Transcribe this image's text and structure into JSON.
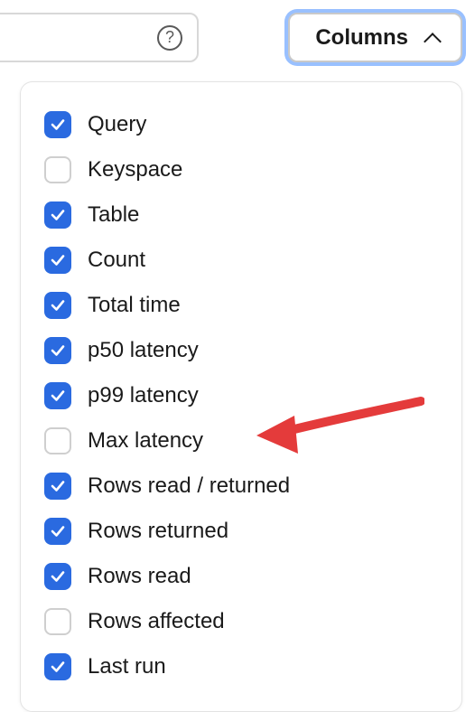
{
  "toolbar": {
    "columns_button_label": "Columns"
  },
  "columns_menu": {
    "options": [
      {
        "label": "Query",
        "checked": true
      },
      {
        "label": "Keyspace",
        "checked": false
      },
      {
        "label": "Table",
        "checked": true
      },
      {
        "label": "Count",
        "checked": true
      },
      {
        "label": "Total time",
        "checked": true
      },
      {
        "label": "p50 latency",
        "checked": true
      },
      {
        "label": "p99 latency",
        "checked": true
      },
      {
        "label": "Max latency",
        "checked": false
      },
      {
        "label": "Rows read / returned",
        "checked": true
      },
      {
        "label": "Rows returned",
        "checked": true
      },
      {
        "label": "Rows read",
        "checked": true
      },
      {
        "label": "Rows affected",
        "checked": false
      },
      {
        "label": "Last run",
        "checked": true
      }
    ]
  },
  "annotation": {
    "arrow_color": "#e43b3b"
  }
}
